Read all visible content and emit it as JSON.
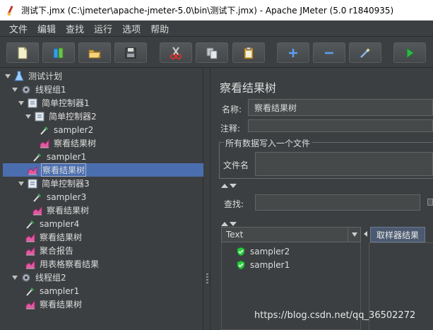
{
  "window": {
    "title": "测试下.jmx (C:\\jmeter\\apache-jmeter-5.0\\bin\\测试下.jmx) - Apache JMeter (5.0 r1840935)"
  },
  "menu": [
    "文件",
    "编辑",
    "查找",
    "运行",
    "选项",
    "帮助"
  ],
  "toolbar": {
    "buttons": [
      "new-icon",
      "templates-icon",
      "open-icon",
      "save-icon",
      "cut-icon",
      "copy-icon",
      "paste-icon",
      "expand-icon",
      "collapse-icon",
      "toggle-icon",
      "start-icon"
    ]
  },
  "tree": {
    "nodes": [
      {
        "label": "测试计划",
        "icon": "test-plan-icon"
      },
      {
        "label": "线程组1",
        "icon": "thread-group-icon"
      },
      {
        "label": "简单控制器1",
        "icon": "controller-icon"
      },
      {
        "label": "简单控制器2",
        "icon": "controller-icon"
      },
      {
        "label": "sampler2",
        "icon": "sampler-icon"
      },
      {
        "label": "察看结果树",
        "icon": "listener-icon"
      },
      {
        "label": "sampler1",
        "icon": "sampler-icon"
      },
      {
        "label": "察看结果树",
        "icon": "listener-icon",
        "selected": true
      },
      {
        "label": "简单控制器3",
        "icon": "controller-icon"
      },
      {
        "label": "sampler3",
        "icon": "sampler-icon"
      },
      {
        "label": "察看结果树",
        "icon": "listener-icon"
      },
      {
        "label": "sampler4",
        "icon": "sampler-icon"
      },
      {
        "label": "察看结果树",
        "icon": "listener-icon"
      },
      {
        "label": "聚合报告",
        "icon": "listener-icon"
      },
      {
        "label": "用表格察看结果",
        "icon": "listener-icon"
      },
      {
        "label": "线程组2",
        "icon": "thread-group-icon"
      },
      {
        "label": "sampler1",
        "icon": "sampler-icon"
      },
      {
        "label": "察看结果树",
        "icon": "listener-icon"
      }
    ]
  },
  "panel": {
    "title": "察看结果树",
    "name_label": "名称:",
    "name_value": "察看结果树",
    "comment_label": "注释:",
    "comment_value": "",
    "file_group_title": "所有数据写入一个文件",
    "filename_label": "文件名",
    "filename_value": "",
    "search_label": "查找:",
    "search_value": "",
    "renderer_select": "Text",
    "results": [
      "sampler2",
      "sampler1"
    ],
    "tab_label": "取样器结果"
  },
  "watermark": "https://blog.csdn.net/qq_36502272",
  "colors": {
    "background": "#3c3f41",
    "selection": "#4b6eaf",
    "success": "#2ecc40"
  }
}
